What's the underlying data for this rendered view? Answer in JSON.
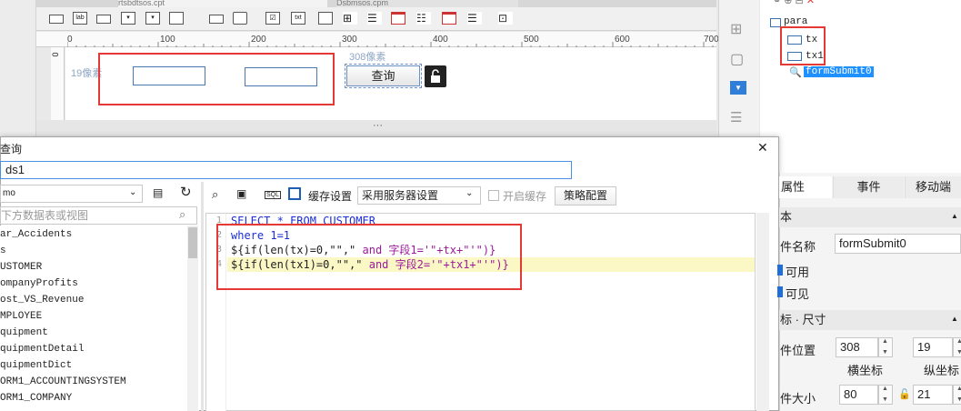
{
  "designer": {
    "tabs": [
      "rtsbdtsos.cpt",
      "Dsbmsos.cpm"
    ],
    "ruler_ticks": [
      "0",
      "100",
      "200",
      "300",
      "400",
      "500",
      "600",
      "700"
    ],
    "left_ruler_label": "0",
    "distance_left": "19像素",
    "distance_top": "308像素",
    "query_button": "查询",
    "resize_handle": "···"
  },
  "tree": {
    "root": "para",
    "items": [
      "tx",
      "tx1"
    ],
    "selected": "formSubmit0"
  },
  "dialog": {
    "title": "查询",
    "name_value": "ds1",
    "close": "✕",
    "db_select": "mo",
    "search_placeholder": "下方数据表或视图",
    "tables": [
      "ar_Accidents",
      "s",
      "USTOMER",
      "ompanyProfits",
      "ost_VS_Revenue",
      "MPLOYEE",
      "quipment",
      "quipmentDetail",
      "quipmentDict",
      "ORM1_ACCOUNTINGSYSTEM",
      "ORM1_COMPANY"
    ],
    "cache_label": "缓存设置",
    "cache_value": "采用服务器设置",
    "enable_cache": "开启缓存",
    "strategy_button": "策略配置",
    "sql_label": "SQL"
  },
  "code": {
    "line_numbers": [
      "1",
      "2",
      "3",
      "4"
    ],
    "line1": "SELECT * FROM CUSTOMER",
    "line2_kw": "where",
    "line2_rest": " 1=1",
    "line3_a": "${if(len(tx)=0,\"\",\"",
    "line3_b": " and ",
    "line3_c": "字段1='\"+tx+\"'\")}",
    "line4_a": "${if(len(tx1)=0,\"\",\"",
    "line4_b": " and ",
    "line4_c": "字段2='\"+tx1+\"'\")}"
  },
  "props": {
    "tabs": [
      "属性",
      "事件",
      "移动端"
    ],
    "section_basic": "本",
    "name_label": "件名称",
    "name_value": "formSubmit0",
    "enabled": "可用",
    "visible": "可见",
    "section_pos": "标 · 尺寸",
    "pos_label": "件位置",
    "pos_x": "308",
    "pos_y": "19",
    "x_caption": "横坐标",
    "y_caption": "纵坐标",
    "size_label": "件大小",
    "width": "80",
    "height": "21"
  },
  "colors": {
    "highlight": "#e53935",
    "selection": "#1e90ff"
  }
}
